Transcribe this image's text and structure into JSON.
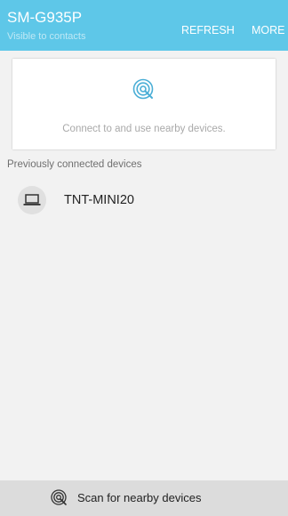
{
  "header": {
    "device_name": "SM-G935P",
    "visibility": "Visible to contacts",
    "refresh_label": "REFRESH",
    "more_label": "MORE"
  },
  "card": {
    "icon": "nearby-scan-icon",
    "message": "Connect to and use nearby devices."
  },
  "previous": {
    "section_label": "Previously connected devices",
    "devices": [
      {
        "name": "TNT-MINI20",
        "icon": "laptop-icon"
      }
    ]
  },
  "bottom_bar": {
    "icon": "nearby-scan-icon",
    "label": "Scan for nearby devices"
  },
  "colors": {
    "header_bg": "#5ec7e8",
    "icon_accent": "#4aaed6",
    "background": "#f2f2f2",
    "bottom_bar_bg": "#dcdcdc"
  }
}
